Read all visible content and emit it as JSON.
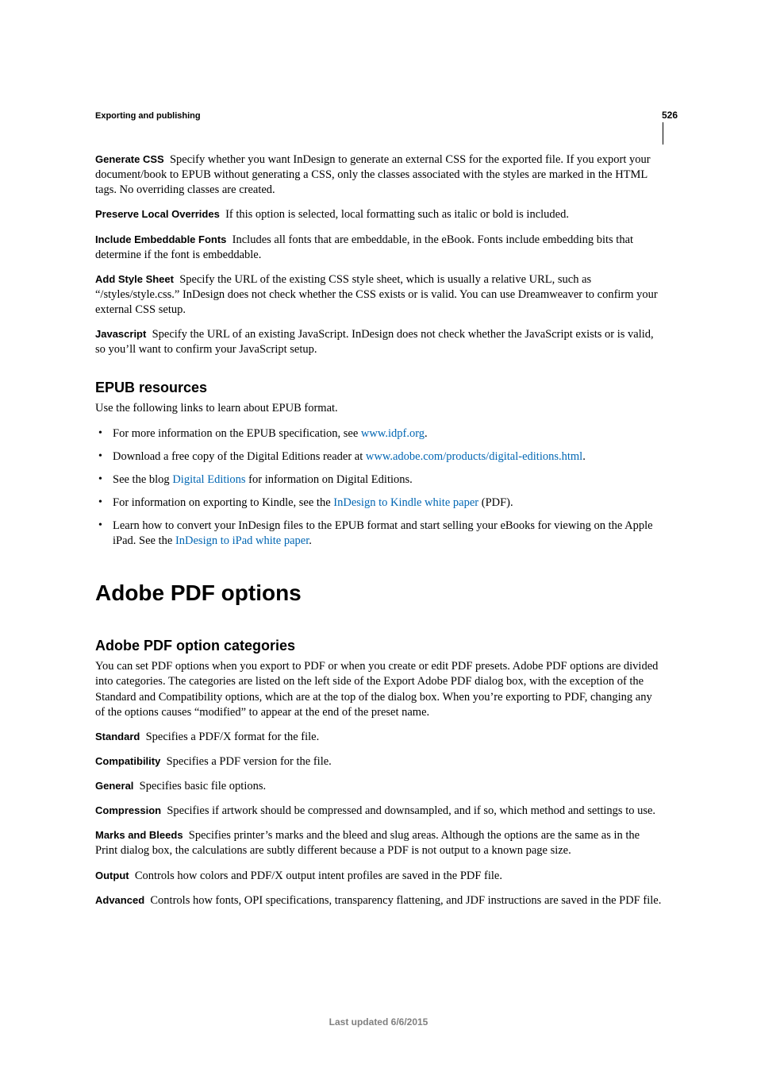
{
  "page_number": "526",
  "section_label": "Exporting and publishing",
  "defs": {
    "generate_css": {
      "term": "Generate CSS",
      "text": "Specify whether you want InDesign to generate an external CSS for the exported file. If you export your document/book to EPUB without generating a CSS, only the classes associated with the styles are marked in the HTML tags. No overriding classes are created."
    },
    "preserve_local": {
      "term": "Preserve Local Overrides",
      "text": "If this option is selected, local formatting such as italic or bold is included."
    },
    "include_fonts": {
      "term": "Include Embeddable Fonts",
      "text": "Includes all fonts that are embeddable, in the eBook. Fonts include embedding bits that determine if the font is embeddable."
    },
    "add_style_sheet": {
      "term": "Add Style Sheet",
      "text": "Specify the URL of the existing CSS style sheet, which is usually a relative URL, such as “/styles/style.css.” InDesign does not check whether the CSS exists or is valid. You can use Dreamweaver to confirm your external CSS setup."
    },
    "javascript": {
      "term": "Javascript",
      "text": "Specify the URL of an existing JavaScript. InDesign does not check whether the JavaScript exists or is valid, so you’ll want to confirm your JavaScript setup."
    }
  },
  "epub": {
    "heading": "EPUB resources",
    "intro": "Use the following links to learn about EPUB format.",
    "items": {
      "i0": {
        "pre": "For more information on the EPUB specification, see ",
        "link": "www.idpf.org",
        "post": "."
      },
      "i1": {
        "pre": "Download a free copy of the Digital Editions reader at ",
        "link": "www.adobe.com/products/digital-editions.html",
        "post": "."
      },
      "i2": {
        "pre": "See the blog ",
        "link": "Digital Editions",
        "post": " for information on Digital Editions."
      },
      "i3": {
        "pre": "For information on exporting to Kindle, see the ",
        "link": "InDesign to Kindle white paper",
        "post": " (PDF)."
      },
      "i4": {
        "pre": "Learn how to convert your InDesign files to the EPUB format and start selling your eBooks for viewing on the Apple iPad. See the ",
        "link": "InDesign to iPad white paper",
        "post": "."
      }
    }
  },
  "pdf": {
    "heading": "Adobe PDF options",
    "subheading": "Adobe PDF option categories",
    "intro": "You can set PDF options when you export to PDF or when you create or edit PDF presets. Adobe PDF options are divided into categories. The categories are listed on the left side of the Export Adobe PDF dialog box, with the exception of the Standard and Compatibility options, which are at the top of the dialog box. When you’re exporting to PDF, changing any of the options causes “modified” to appear at the end of the preset name.",
    "cats": {
      "standard": {
        "term": "Standard",
        "text": "Specifies a PDF/X format for the file."
      },
      "compatibility": {
        "term": "Compatibility",
        "text": "Specifies a PDF version for the file."
      },
      "general": {
        "term": "General",
        "text": "Specifies basic file options."
      },
      "compression": {
        "term": "Compression",
        "text": "Specifies if artwork should be compressed and downsampled, and if so, which method and settings to use."
      },
      "marks": {
        "term": "Marks and Bleeds",
        "text": "Specifies printer’s marks and the bleed and slug areas. Although the options are the same as in the Print dialog box, the calculations are subtly different because a PDF is not output to a known page size."
      },
      "output": {
        "term": "Output",
        "text": "Controls how colors and PDF/X output intent profiles are saved in the PDF file."
      },
      "advanced": {
        "term": "Advanced",
        "text": "Controls how fonts, OPI specifications, transparency flattening, and JDF instructions are saved in the PDF file."
      }
    }
  },
  "footer": "Last updated 6/6/2015"
}
